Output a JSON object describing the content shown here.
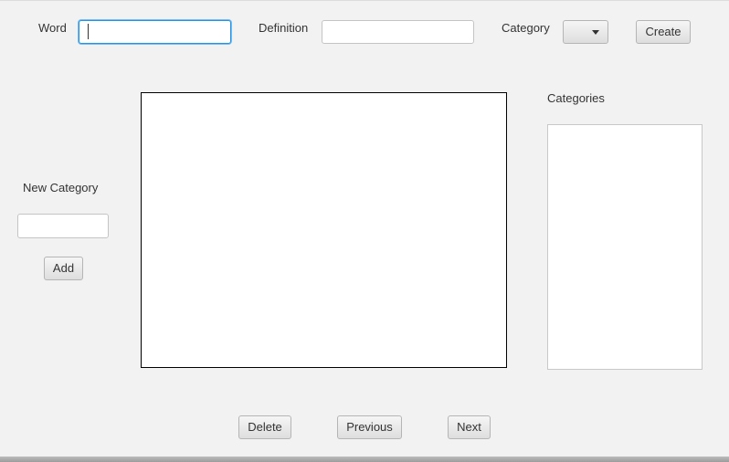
{
  "top_form": {
    "word_label": "Word",
    "word_value": "",
    "definition_label": "Definition",
    "definition_value": "",
    "category_label": "Category",
    "category_selected": "",
    "create_label": "Create"
  },
  "new_category": {
    "label": "New Category",
    "value": "",
    "add_label": "Add"
  },
  "categories_panel": {
    "label": "Categories",
    "items": []
  },
  "navigation": {
    "delete_label": "Delete",
    "previous_label": "Previous",
    "next_label": "Next"
  },
  "colors": {
    "window_background": "#f2f2f2",
    "focus_ring": "#1f95e8",
    "field_background": "#ffffff"
  },
  "icons": {
    "category_dropdown": "chevron-down-icon"
  }
}
